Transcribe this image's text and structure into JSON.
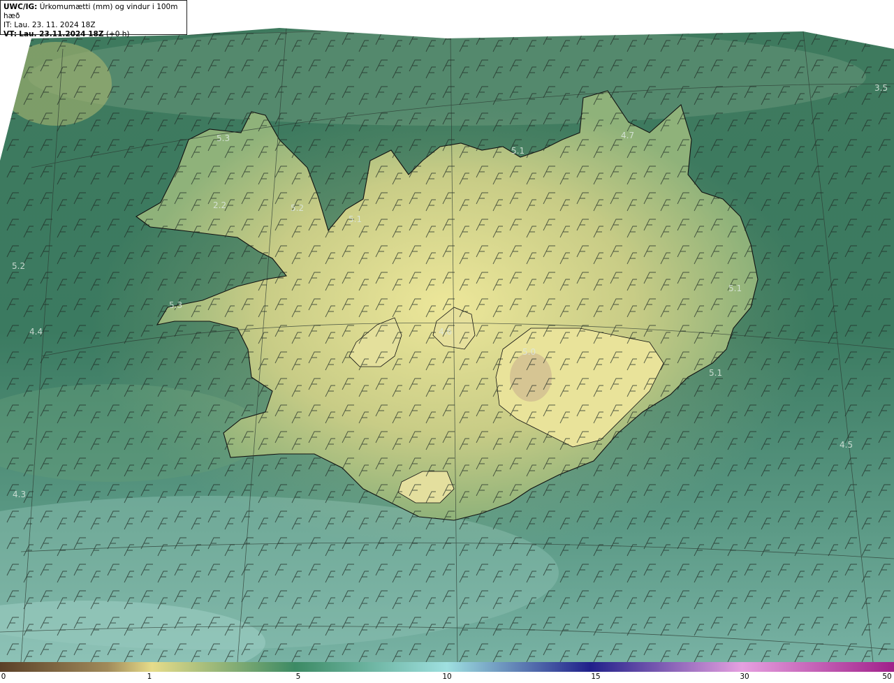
{
  "header": {
    "model": "UWC/IG:",
    "title": "Úrkomumætti (mm) og vindur i 100m hæð",
    "issue_time": "IT: Lau. 23. 11. 2024 18Z",
    "valid_prefix": "VT:",
    "valid_time": "Lau. 23.11.2024 18Z",
    "valid_offset": "(+0 h)"
  },
  "value_labels": [
    "5.3",
    "5.2",
    "5.1",
    "5.1",
    "4.7",
    "3.5",
    "5.2",
    "2.2",
    "5.3",
    "4.4",
    "4.6",
    "5.0",
    "5.1",
    "5.1",
    "4.5",
    "4.3"
  ],
  "colorbar": {
    "ticks": [
      "0",
      "1",
      "5",
      "10",
      "15",
      "30",
      "50"
    ],
    "colors": [
      "#5a4028",
      "#a08a5a",
      "#e6dc8a",
      "#3c8a64",
      "#9fe0e0",
      "#20208a",
      "#e6a0e0",
      "#a0208a"
    ]
  },
  "colors": {
    "sea_low": "#3c7a5c",
    "sea_light": "#6fa994",
    "land_high": "#e8e394",
    "coast": "#111111"
  }
}
